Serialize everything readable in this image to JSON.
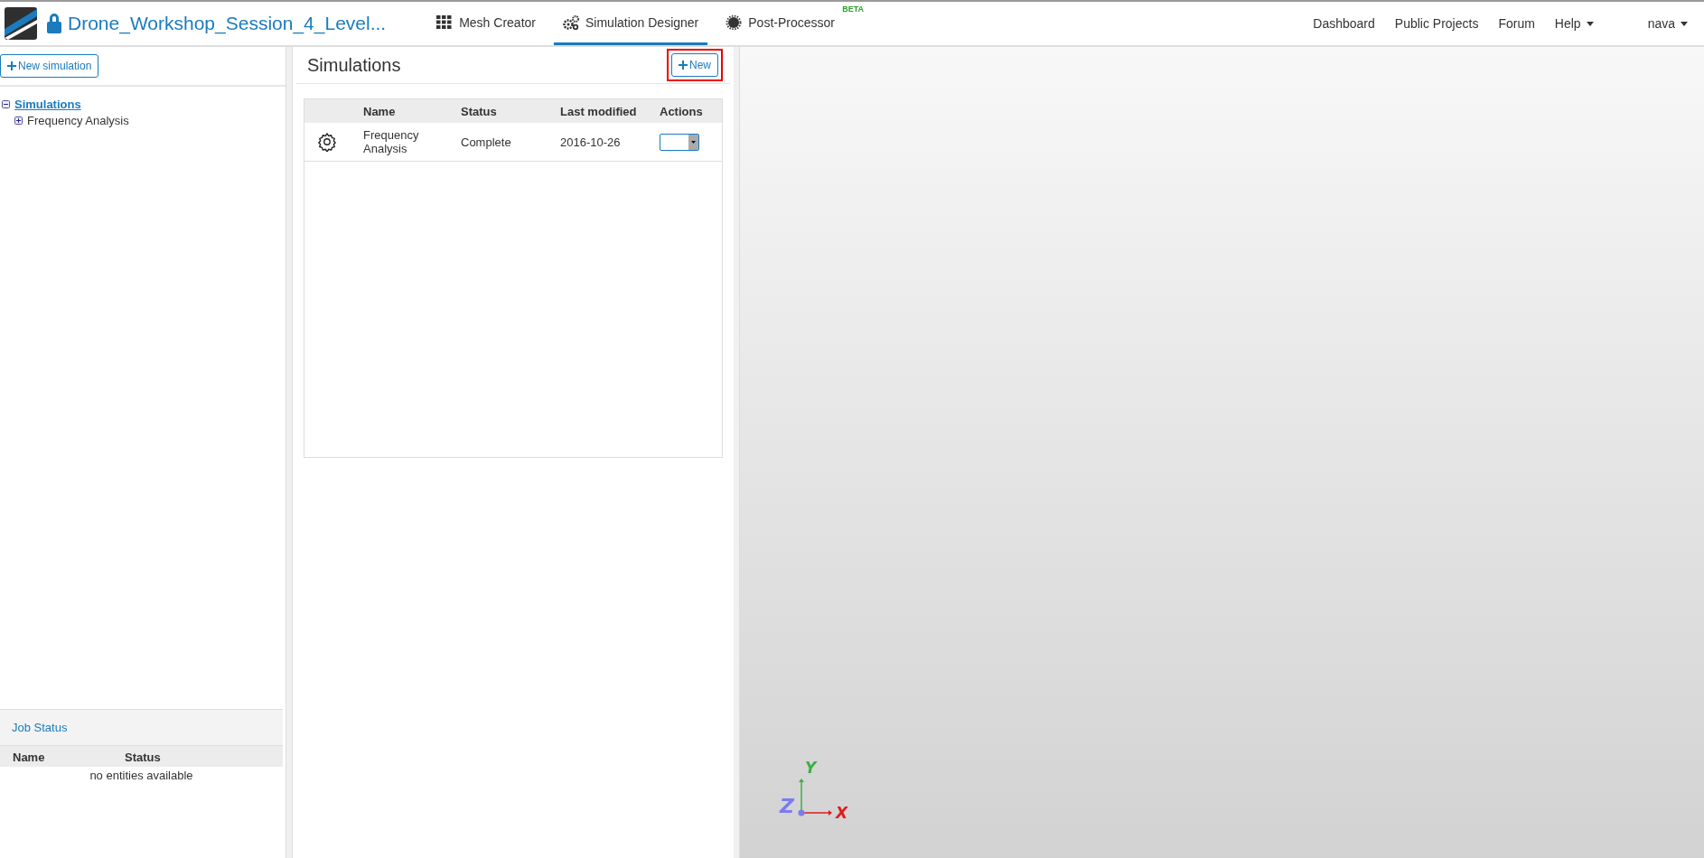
{
  "header": {
    "project_title": "Drone_Workshop_Session_4_Level...",
    "tabs": [
      {
        "label": "Mesh Creator",
        "kind": "grid",
        "selected": false
      },
      {
        "label": "Simulation Designer",
        "kind": "gears",
        "selected": true
      },
      {
        "label": "Post-Processor",
        "kind": "burst",
        "selected": false,
        "badge": "BETA"
      }
    ],
    "links": [
      {
        "label": "Dashboard",
        "dropdown": false
      },
      {
        "label": "Public Projects",
        "dropdown": false
      },
      {
        "label": "Forum",
        "dropdown": false
      },
      {
        "label": "Help",
        "dropdown": true
      }
    ],
    "user": {
      "label": "nava",
      "dropdown": true
    }
  },
  "sidebar": {
    "new_button": "New simulation",
    "tree": [
      {
        "label": "Simulations",
        "expanded": true,
        "children": [
          {
            "label": "Frequency Analysis",
            "expanded": false
          }
        ]
      }
    ],
    "job_status": {
      "title": "Job Status",
      "columns": [
        "Name",
        "Status"
      ],
      "empty_text": "no entities available"
    }
  },
  "simulations": {
    "title": "Simulations",
    "new_button": {
      "label": "New",
      "highlighted": true
    },
    "columns": [
      "",
      "Name",
      "Status",
      "Last modified",
      "Actions"
    ],
    "rows": [
      {
        "name": "Frequency Analysis",
        "status": "Complete",
        "last_modified": "2016-10-26"
      }
    ]
  },
  "viewport": {
    "axes": [
      {
        "label": "X",
        "color": "#e01b1b"
      },
      {
        "label": "Y",
        "color": "#3cb043"
      },
      {
        "label": "Z",
        "color": "#7b7bf0"
      }
    ]
  }
}
